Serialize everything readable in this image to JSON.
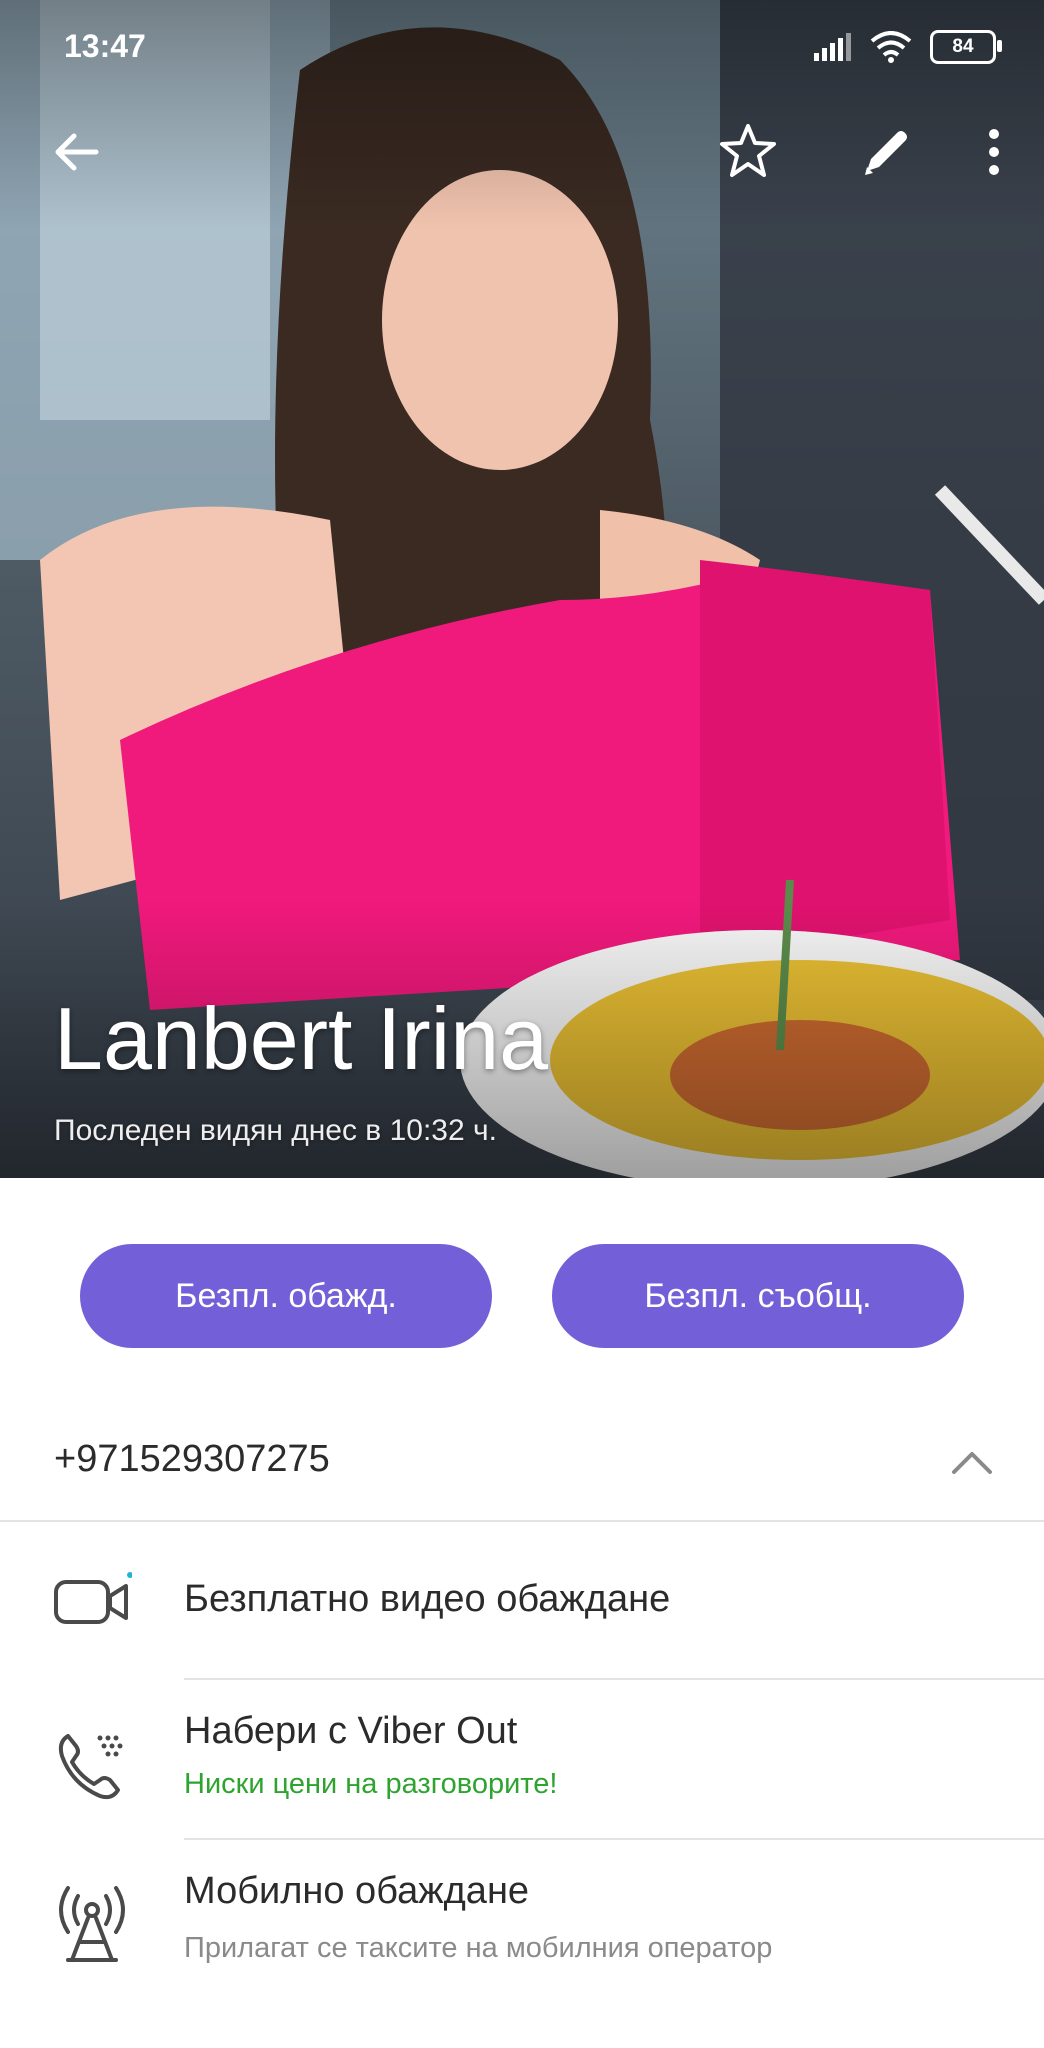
{
  "status_bar": {
    "time": "13:47",
    "battery": "84"
  },
  "profile": {
    "name": "Lanbert Irina",
    "last_seen": "Последен видян днес в 10:32 ч."
  },
  "actions": {
    "free_call": "Безпл. обажд.",
    "free_message": "Безпл. съобщ."
  },
  "phone": {
    "number": "+971529307275"
  },
  "options": [
    {
      "title": "Безплатно видео обаждане",
      "icon": "video-camera-icon"
    },
    {
      "title": "Набери с Viber Out",
      "subtitle": "Ниски цени на разговорите!",
      "icon": "viber-out-phone-icon"
    },
    {
      "title": "Мобилно обаждане",
      "subtitle": "Прилагат се таксите на мобилния оператор",
      "icon": "cell-tower-icon"
    }
  ],
  "colors": {
    "accent": "#7360d8",
    "viber_out_subtitle": "#2fa32f",
    "muted_subtitle": "#8a8a8a",
    "new_dot": "#1fb3d8"
  }
}
